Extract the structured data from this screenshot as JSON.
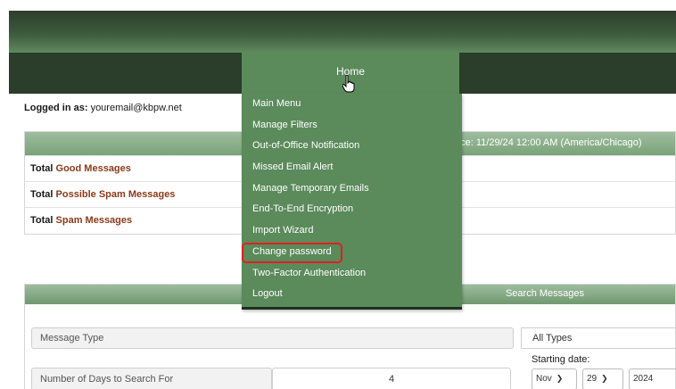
{
  "nav": {
    "home_label": "Home"
  },
  "user": {
    "logged_in_label": "Logged in as:",
    "email": "youremail@kbpw.net"
  },
  "summary": {
    "since_text": "nce: 11/29/24 12:00 AM (America/Chicago)",
    "rows": [
      {
        "prefix": "Total",
        "link": "Good Messages"
      },
      {
        "prefix": "Total",
        "link": "Possible Spam Messages"
      },
      {
        "prefix": "Total",
        "link": "Spam Messages"
      }
    ]
  },
  "menu": {
    "items": [
      "Main Menu",
      "Manage Filters",
      "Out-of-Office Notification",
      "Missed Email Alert",
      "Manage Temporary Emails",
      "End-To-End Encryption",
      "Import Wizard",
      "Change password",
      "Two-Factor Authentication",
      "Logout"
    ],
    "highlighted": "Change password"
  },
  "search": {
    "title": "Search Messages",
    "message_type_label": "Message Type",
    "message_type_value": "All Types",
    "days_label": "Number of Days to Search For",
    "days_value": "4",
    "starting_date_label": "Starting date:",
    "month": "Nov",
    "day": "29",
    "year": "2024"
  },
  "colors": {
    "menu_bg": "#5b8a5b",
    "header_dark": "#2b3d2b",
    "link_color": "#8b3a1a",
    "highlight_border": "#e02020"
  },
  "icons": {
    "cursor": "hand-pointer-icon"
  }
}
